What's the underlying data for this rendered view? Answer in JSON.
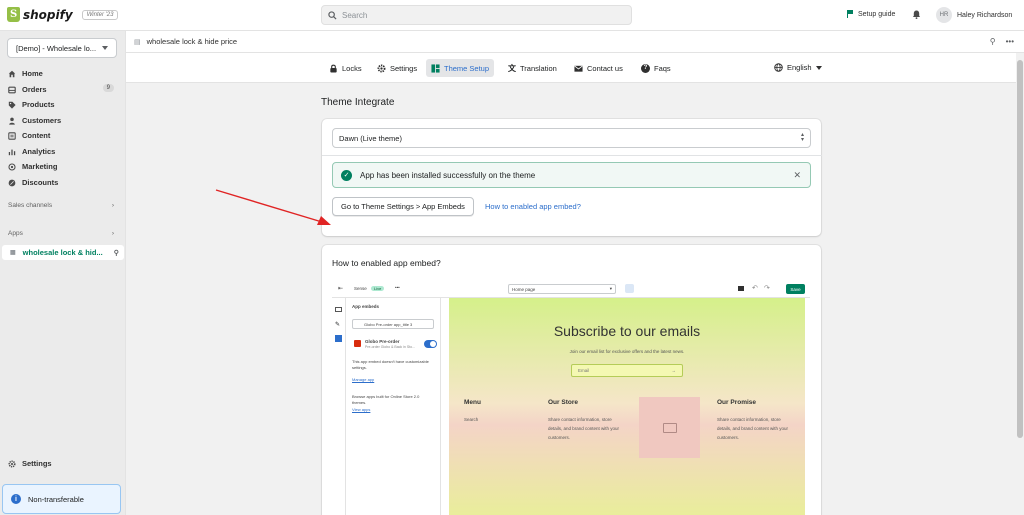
{
  "topbar": {
    "brand": "shopify",
    "edition": "Winter '23",
    "search_placeholder": "Search",
    "setup_guide": "Setup guide",
    "user_initials": "HR",
    "user_name": "Haley Richardson"
  },
  "sidebar": {
    "store": "[Demo] - Wholesale lo...",
    "items": [
      {
        "label": "Home",
        "icon": "home-icon"
      },
      {
        "label": "Orders",
        "icon": "orders-icon",
        "badge": "9"
      },
      {
        "label": "Products",
        "icon": "tag-icon"
      },
      {
        "label": "Customers",
        "icon": "person-icon"
      },
      {
        "label": "Content",
        "icon": "content-icon"
      },
      {
        "label": "Analytics",
        "icon": "analytics-icon"
      },
      {
        "label": "Marketing",
        "icon": "marketing-icon"
      },
      {
        "label": "Discounts",
        "icon": "discount-icon"
      }
    ],
    "sales_channels": "Sales channels",
    "apps": "Apps",
    "active_app": "wholesale lock & hid...",
    "settings": "Settings",
    "non_transferable": "Non-transferable"
  },
  "app_header": {
    "title": "wholesale lock & hide price"
  },
  "app_nav": {
    "tabs": [
      {
        "label": "Locks",
        "icon": "lock-icon"
      },
      {
        "label": "Settings",
        "icon": "gear-icon"
      },
      {
        "label": "Theme Setup",
        "icon": "theme-icon"
      },
      {
        "label": "Translation",
        "icon": "translate-icon"
      },
      {
        "label": "Contact us",
        "icon": "mail-icon"
      },
      {
        "label": "Faqs",
        "icon": "question-icon"
      }
    ],
    "active_tab": "Theme Setup",
    "language": "English"
  },
  "page": {
    "title": "Theme Integrate",
    "theme_value": "Dawn (Live theme)",
    "banner_message": "App has been installed successfully on the theme",
    "go_button": "Go to Theme Settings > App Embeds",
    "help_link": "How to enabled app embed?",
    "help_heading": "How to enabled app embed?"
  },
  "embed_screenshot": {
    "store_label": "Sense",
    "live_label": "Live",
    "page_select": "Home page",
    "save": "Save",
    "panel_title": "App embeds",
    "search_value": "Globo Pre-order app_title 3",
    "app_name": "Globo Pre-order",
    "app_sub": "Pre-order Globo & Back in Sto...",
    "note": "This app embed doesn't have customizable settings.",
    "manage_link": "Manage app",
    "browse_text": "Browse apps built for Online Store 2.0 themes.",
    "view_link": "View apps",
    "preview_title": "Subscribe to our emails",
    "preview_sub": "Join our email list for exclusive offers and the latest news.",
    "email_placeholder": "Email",
    "menu": "Menu",
    "menu_item": "Search",
    "our_store": "Our Store",
    "our_store_text": "Share contact information, store details, and brand content with your customers.",
    "our_promise": "Our Promise",
    "our_promise_text": "Share contact information, store details, and brand content with your customers."
  },
  "colors": {
    "primary_green": "#008060",
    "link_blue": "#2c6ecb",
    "annotation_arrow": "#e02424"
  }
}
